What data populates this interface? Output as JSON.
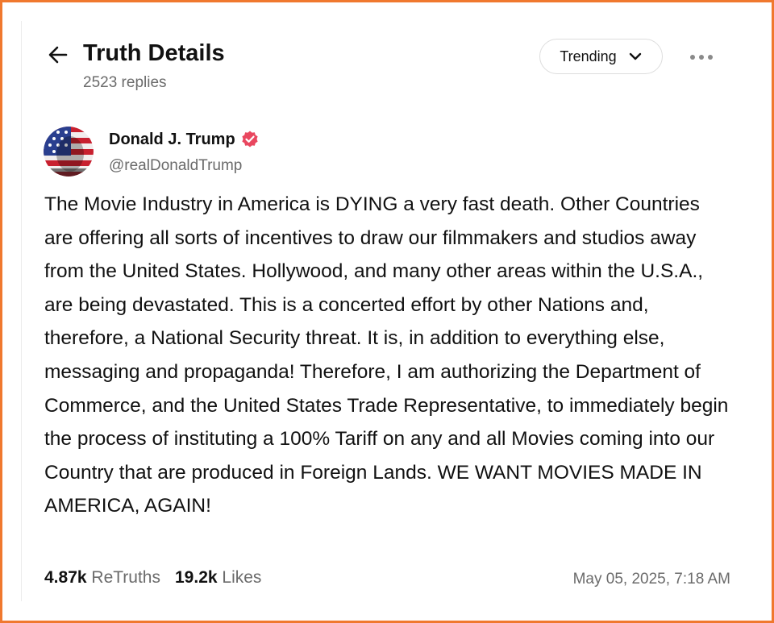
{
  "header": {
    "title": "Truth Details",
    "replies": "2523 replies",
    "sort_label": "Trending"
  },
  "post": {
    "author_name": "Donald J. Trump",
    "author_handle": "@realDonaldTrump",
    "text": "The Movie Industry in America is DYING a very fast death. Other Countries are offering all sorts of incentives to draw our filmmakers and studios away from the United States. Hollywood, and many other areas within the U.S.A., are being devastated. This is a concerted effort by other Nations and, therefore, a National Security threat. It is, in addition to everything else, messaging and propaganda! Therefore, I am authorizing the Department of Commerce, and the United States Trade Representative, to immediately begin the process of instituting a 100% Tariff on any and all Movies coming into our Country that are produced in Foreign Lands. WE WANT MOVIES MADE IN AMERICA, AGAIN!",
    "retruths_count": "4.87k",
    "retruths_label": "ReTruths",
    "likes_count": "19.2k",
    "likes_label": "Likes",
    "timestamp": "May 05, 2025, 7:18 AM"
  },
  "icons": {
    "back": "arrow-left-icon",
    "sort": "chevron-down-icon",
    "more": "ellipsis-icon",
    "verified": "verified-badge-icon"
  },
  "colors": {
    "border": "#f0782e",
    "verified": "#e9475f",
    "muted_text": "#6b6b6b",
    "primary_text": "#111111"
  }
}
